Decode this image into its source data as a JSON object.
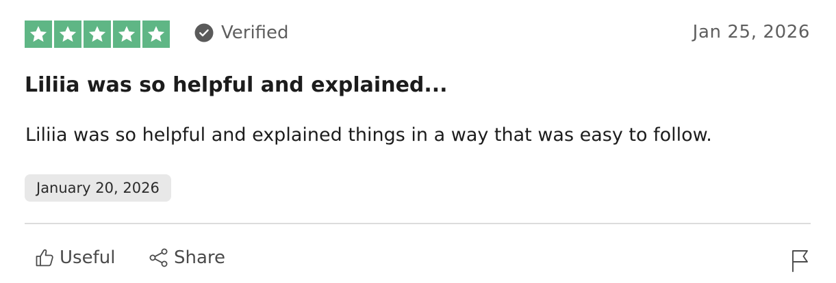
{
  "review": {
    "rating": 5,
    "rating_max": 5,
    "star_color": "#5fb685",
    "verified_label": "Verified",
    "review_date": "Jan 25, 2026",
    "title": "Liliia was so helpful and explained...",
    "body": "Liliia was so helpful and explained things in a way that was easy to follow.",
    "experience_date": "January 20, 2026"
  },
  "actions": {
    "useful_label": "Useful",
    "useful_icon": "thumbs-up-icon",
    "share_label": "Share",
    "share_icon": "share-icon",
    "report_icon": "flag-icon"
  }
}
